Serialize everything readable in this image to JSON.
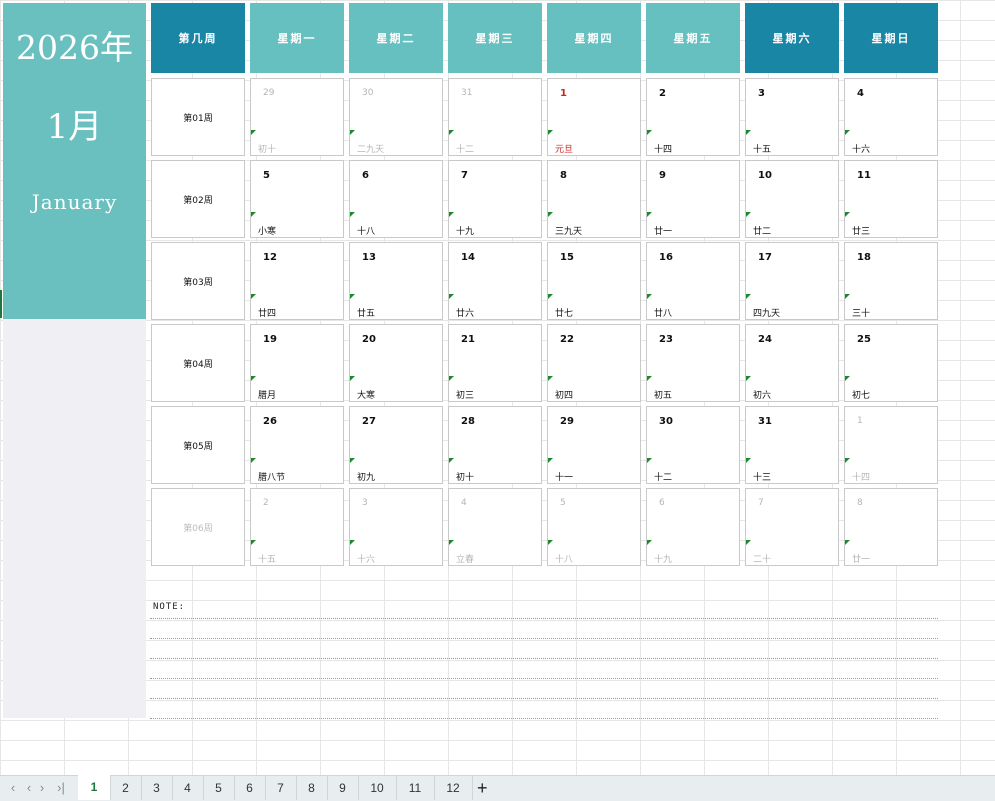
{
  "sidebar": {
    "year": "2026年",
    "month": "1月",
    "month_en": "January"
  },
  "headers": [
    "第几周",
    "星期一",
    "星期二",
    "星期三",
    "星期四",
    "星期五",
    "星期六",
    "星期日"
  ],
  "weeks": [
    "第01周",
    "第02周",
    "第03周",
    "第04周",
    "第05周",
    "第06周"
  ],
  "days": [
    [
      {
        "d": "29",
        "l": "初十",
        "o": true
      },
      {
        "d": "30",
        "l": "二九天",
        "o": true
      },
      {
        "d": "31",
        "l": "十二",
        "o": true
      },
      {
        "d": "1",
        "l": "元旦",
        "h": true
      },
      {
        "d": "2",
        "l": "十四"
      },
      {
        "d": "3",
        "l": "十五"
      },
      {
        "d": "4",
        "l": "十六"
      }
    ],
    [
      {
        "d": "5",
        "l": "小寒"
      },
      {
        "d": "6",
        "l": "十八"
      },
      {
        "d": "7",
        "l": "十九"
      },
      {
        "d": "8",
        "l": "三九天"
      },
      {
        "d": "9",
        "l": "廿一"
      },
      {
        "d": "10",
        "l": "廿二"
      },
      {
        "d": "11",
        "l": "廿三"
      }
    ],
    [
      {
        "d": "12",
        "l": "廿四"
      },
      {
        "d": "13",
        "l": "廿五"
      },
      {
        "d": "14",
        "l": "廿六"
      },
      {
        "d": "15",
        "l": "廿七"
      },
      {
        "d": "16",
        "l": "廿八"
      },
      {
        "d": "17",
        "l": "四九天"
      },
      {
        "d": "18",
        "l": "三十"
      }
    ],
    [
      {
        "d": "19",
        "l": "腊月"
      },
      {
        "d": "20",
        "l": "大寒"
      },
      {
        "d": "21",
        "l": "初三"
      },
      {
        "d": "22",
        "l": "初四"
      },
      {
        "d": "23",
        "l": "初五"
      },
      {
        "d": "24",
        "l": "初六"
      },
      {
        "d": "25",
        "l": "初七"
      }
    ],
    [
      {
        "d": "26",
        "l": "腊八节"
      },
      {
        "d": "27",
        "l": "初九"
      },
      {
        "d": "28",
        "l": "初十"
      },
      {
        "d": "29",
        "l": "十一"
      },
      {
        "d": "30",
        "l": "十二"
      },
      {
        "d": "31",
        "l": "十三"
      },
      {
        "d": "1",
        "l": "十四",
        "o": true
      }
    ],
    [
      {
        "d": "2",
        "l": "十五",
        "o": true
      },
      {
        "d": "3",
        "l": "十六",
        "o": true
      },
      {
        "d": "4",
        "l": "立春",
        "o": true
      },
      {
        "d": "5",
        "l": "十八",
        "o": true
      },
      {
        "d": "6",
        "l": "十九",
        "o": true
      },
      {
        "d": "7",
        "l": "二十",
        "o": true
      },
      {
        "d": "8",
        "l": "廿一",
        "o": true
      }
    ]
  ],
  "note_label": "NOTE:",
  "tabs": [
    "1",
    "2",
    "3",
    "4",
    "5",
    "6",
    "7",
    "8",
    "9",
    "10",
    "11",
    "12"
  ],
  "active_tab": "1",
  "tab_nav": {
    "first": "‹",
    "prev": "‹",
    "next": "›",
    "last": "›|",
    "add": "+"
  },
  "colors": {
    "teal": "#66c0c0",
    "header_dark": "#1a86a6",
    "holiday": "#d42020",
    "active_tab": "#1a7a3c"
  }
}
